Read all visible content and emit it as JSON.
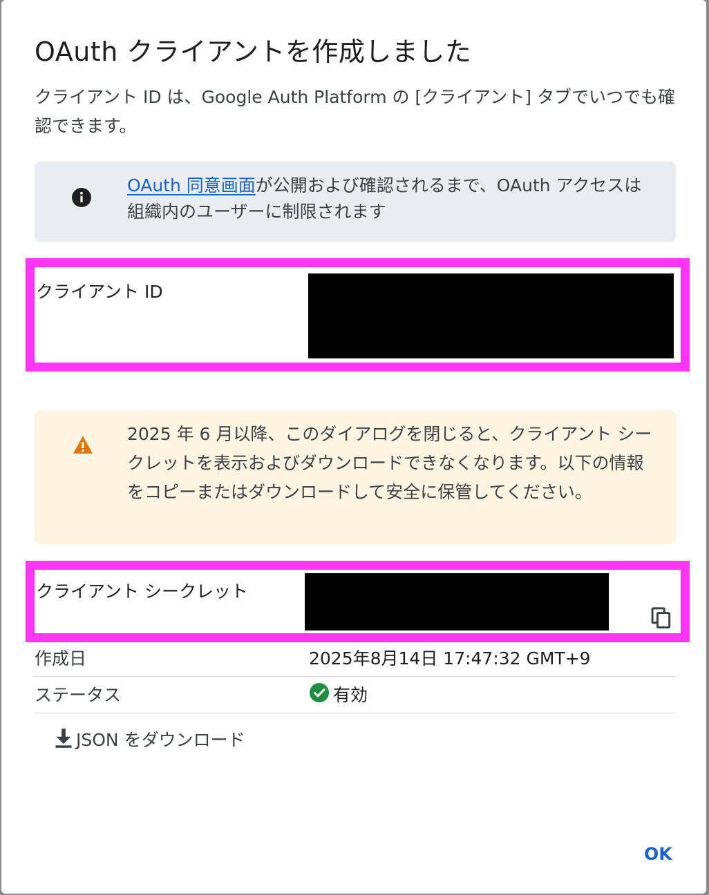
{
  "dialog": {
    "title": "OAuth クライアントを作成しました",
    "subtitle": "クライアント ID は、Google Auth Platform の [クライアント] タブでいつでも確認できます。"
  },
  "info_banner": {
    "icon": "info-icon",
    "link_text": "OAuth 同意画面",
    "text": "が公開および確認されるまで、OAuth アクセスは組織内のユーザーに制限されます"
  },
  "client_id": {
    "label": "クライアント ID"
  },
  "warning_banner": {
    "icon": "warning-icon",
    "text": "2025 年 6 月以降、このダイアログを閉じると、クライアント シークレットを表示およびダウンロードできなくなります。以下の情報をコピーまたはダウンロードして安全に保管してください。"
  },
  "client_secret": {
    "label": "クライアント シークレット",
    "copy_icon": "copy-icon"
  },
  "details": {
    "created_label": "作成日",
    "created_value": "2025年8月14日 17:47:32 GMT+9",
    "status_label": "ステータス",
    "status_value": "有効",
    "status_icon": "check-circle-icon"
  },
  "actions": {
    "download_json": "JSON をダウンロード",
    "ok": "OK"
  },
  "colors": {
    "link": "#1a63c9",
    "highlight": "#ff34f5",
    "info_bg": "#e9ecf1",
    "warning_bg": "#fdf5e1",
    "warning_icon": "#e37400",
    "success": "#1e8e3e"
  }
}
